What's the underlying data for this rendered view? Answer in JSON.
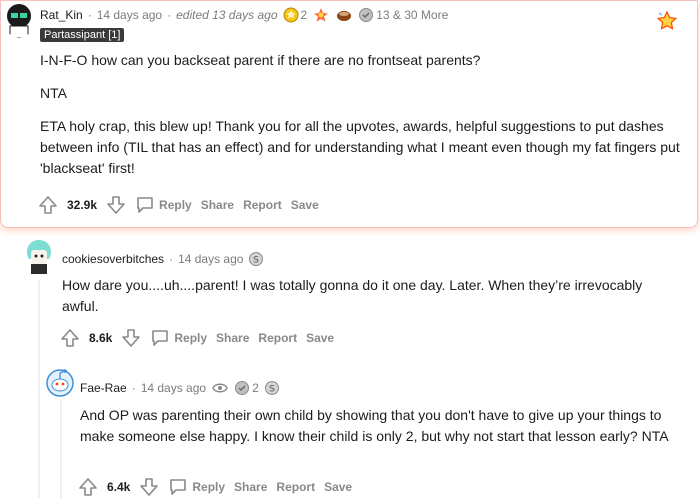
{
  "comment1": {
    "author": "Rat_Kin",
    "time": "14 days ago",
    "edited": "edited 13 days ago",
    "award_count_1": "2",
    "award_summary": "13 & 30 More",
    "flair": "Partassipant [1]",
    "paragraphs": [
      "I-N-F-O how can you backseat parent if there are no frontseat parents?",
      "NTA",
      "ETA holy crap, this blew up! Thank you for all the upvotes, awards, helpful suggestions to put dashes between info (TIL that has an effect) and for understanding what I meant even though my fat fingers put 'blackseat' first!"
    ],
    "votes": "32.9k",
    "actions": {
      "reply": "Reply",
      "share": "Share",
      "report": "Report",
      "save": "Save"
    }
  },
  "comment2": {
    "author": "cookiesoverbitches",
    "time": "14 days ago",
    "paragraphs": [
      "How dare you....uh....parent! I was totally gonna do it one day. Later. When they’re irrevocably awful."
    ],
    "votes": "8.6k",
    "actions": {
      "reply": "Reply",
      "share": "Share",
      "report": "Report",
      "save": "Save"
    }
  },
  "comment3": {
    "author": "Fae-Rae",
    "time": "14 days ago",
    "award_count": "2",
    "paragraphs": [
      "And OP was parenting their own child by showing that you don't have to give up your things to make someone else happy. I know their child is only 2, but why not start that lesson early? NTA"
    ],
    "votes": "6.4k",
    "actions": {
      "reply": "Reply",
      "share": "Share",
      "report": "Report",
      "save": "Save"
    }
  },
  "colors": {
    "accent": "#ff4500",
    "muted": "#878a8c",
    "text": "#1c1c1c"
  }
}
